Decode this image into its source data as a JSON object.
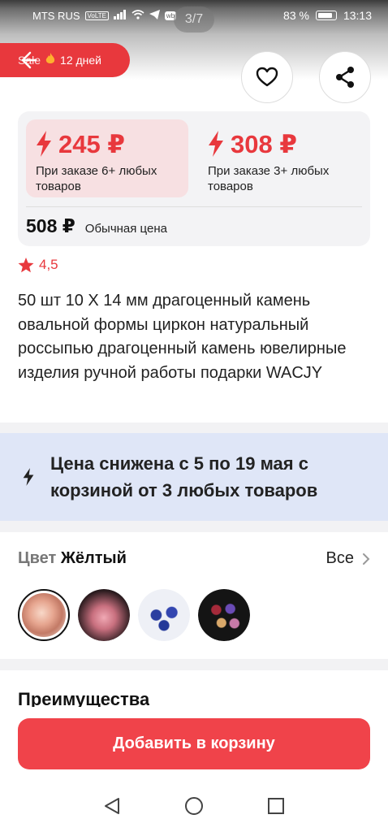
{
  "status_bar": {
    "carrier": "MTS RUS",
    "volte": "VoLTE",
    "battery": "83 %",
    "time": "13:13"
  },
  "gallery": {
    "counter": "3/7"
  },
  "sale_badge": {
    "label": "Sale",
    "countdown": "12 дней"
  },
  "prices": {
    "tiers": [
      {
        "price": "245 ₽",
        "condition": "При заказе 6+ любых товаров"
      },
      {
        "price": "308 ₽",
        "condition": "При заказе 3+ любых товаров"
      }
    ],
    "regular_price": "508 ₽",
    "regular_label": "Обычная цена"
  },
  "rating": {
    "value": "4,5"
  },
  "product": {
    "title": "50 шт 10 Х 14 мм драгоценный камень овальной формы циркон натуральный россыпью драгоценный камень ювелирные изделия ручной работы подарки WACJY"
  },
  "promo": {
    "text": "Цена снижена с 5 по 19 мая с корзиной от 3 любых товаров"
  },
  "color": {
    "label": "Цвет",
    "selected": "Жёлтый",
    "see_all": "Все",
    "options": [
      "peach-stones",
      "pink-stones",
      "blue-stones",
      "mixed-stones"
    ]
  },
  "advantages": {
    "heading": "Преимущества"
  },
  "cart": {
    "button_label": "Добавить в корзину"
  },
  "colors": {
    "accent_red": "#e8383d",
    "button_red": "#f0434a",
    "promo_bg": "#dfe6f7",
    "tier_bg": "#f7e0e2"
  }
}
